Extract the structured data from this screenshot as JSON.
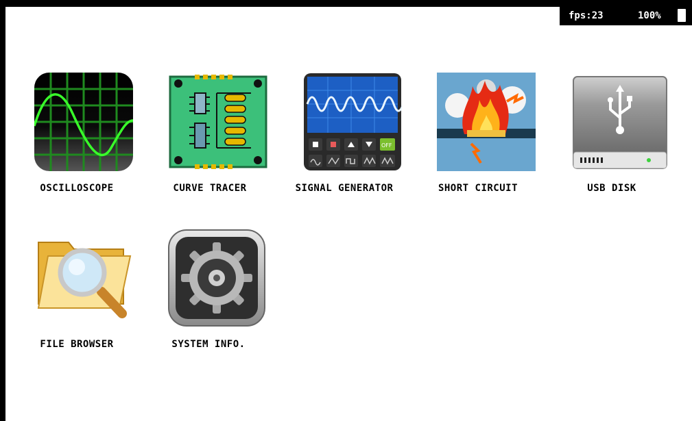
{
  "status_bar": {
    "fps": "fps:23",
    "battery": "100%",
    "battery_icon": "battery-full-icon"
  },
  "apps": [
    {
      "label": "OSCILLOSCOPE",
      "icon": "oscilloscope-icon"
    },
    {
      "label": "CURVE TRACER",
      "icon": "circuit-board-icon"
    },
    {
      "label": "SIGNAL GENERATOR",
      "icon": "signal-generator-icon"
    },
    {
      "label": "SHORT CIRCUIT",
      "icon": "short-circuit-fire-icon"
    },
    {
      "label": "USB DISK",
      "icon": "usb-disk-icon"
    },
    {
      "label": "FILE BROWSER",
      "icon": "folder-search-icon"
    },
    {
      "label": "SYSTEM INFO.",
      "icon": "gear-icon"
    }
  ]
}
